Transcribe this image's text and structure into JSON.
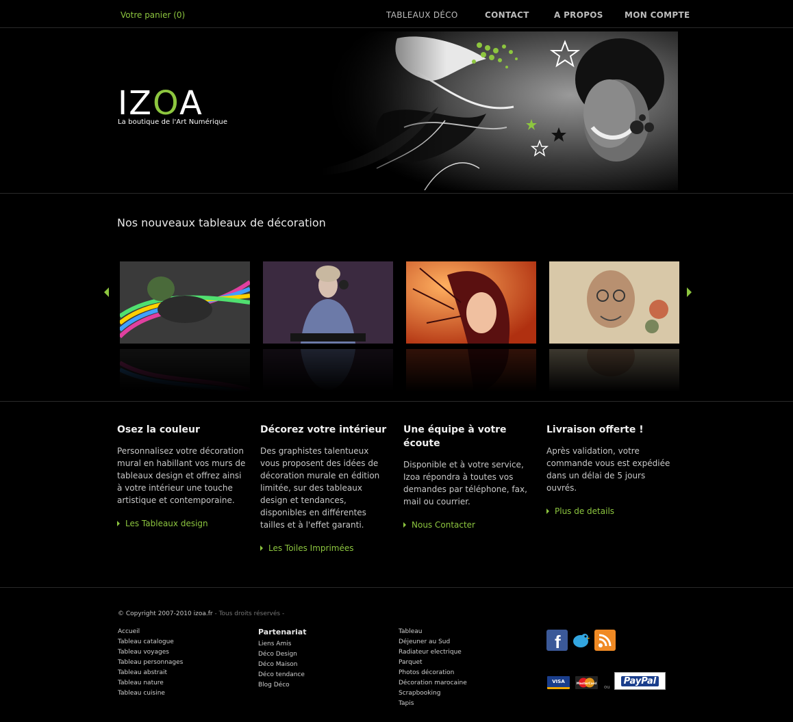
{
  "topbar": {
    "cart": "Votre panier (0)",
    "nav": [
      "TABLEAUX DÉCO",
      "CONTACT",
      "A PROPOS",
      "MON COMPTE"
    ]
  },
  "header": {
    "logo_text": "IZOA",
    "logo_tagline": "La boutique de l'Art Numérique"
  },
  "carousel": {
    "title": "Nos nouveaux tableaux de décoration"
  },
  "features": [
    {
      "title": "Osez la couleur",
      "text": "Personnalisez votre décoration mural en habillant vos murs de tableaux design et offrez ainsi à votre intérieur une touche artistique et contemporaine.",
      "link": "Les Tableaux design"
    },
    {
      "title": "Décorez votre intérieur",
      "text": "Des graphistes talentueux vous proposent des idées de décoration murale en édition limitée, sur des tableaux design et tendances, disponibles en différentes tailles et à l'effet garanti.",
      "link": "Les Toiles Imprimées"
    },
    {
      "title": "Une équipe à votre écoute",
      "text": "Disponible et à votre service, Izoa répondra à toutes vos demandes par téléphone, fax, mail ou courrier.",
      "link": "Nous Contacter"
    },
    {
      "title": "Livraison offerte !",
      "text": "Après validation, votre commande vous est expédiée dans un délai de 5 jours ouvrés.",
      "link": "Plus de details"
    }
  ],
  "footer": {
    "copyright": "© Copyright 2007-2010 izoa.fr",
    "rights": " - Tous droits réservés -",
    "col1": [
      "Accueil",
      "Tableau catalogue",
      "Tableau voyages",
      "Tableau personnages",
      "Tableau abstrait",
      "Tableau nature",
      "Tableau cuisine"
    ],
    "col2_title": "Partenariat",
    "col2": [
      "Liens Amis",
      "Déco Design",
      "Déco Maison",
      "Déco tendance",
      "Blog Déco"
    ],
    "col3": [
      "Tableau",
      "Déjeuner au Sud",
      "Radiateur electrique",
      "Parquet",
      "Photos décoration",
      "Décoration marocaine",
      "Scrapbooking",
      "Tapis"
    ],
    "pay_visa": "VISA",
    "pay_mastercard": "MasterCard",
    "pay_or": "ou",
    "pay_paypal": "PayPal"
  },
  "colors": {
    "accent": "#8dc63f",
    "background": "#000000",
    "text": "#c8c8c8"
  }
}
